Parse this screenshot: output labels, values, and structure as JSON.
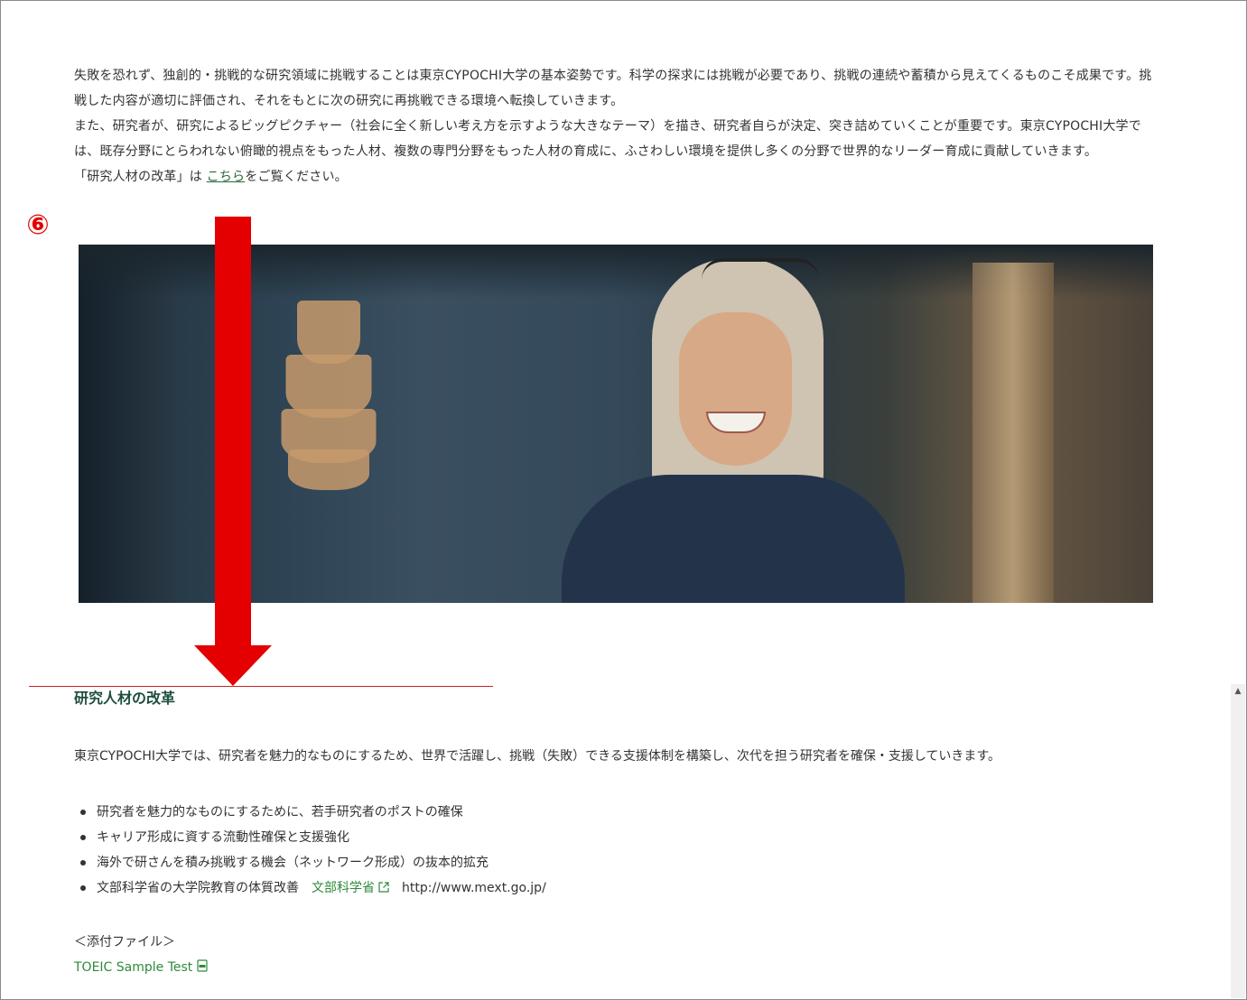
{
  "intro": {
    "paragraph1": "失敗を恐れず、独創的・挑戦的な研究領域に挑戦することは東京CYPOCHI大学の基本姿勢です。科学の探求には挑戦が必要であり、挑戦の連続や蓄積から見えてくるものこそ成果です。挑戦した内容が適切に評価され、それをもとに次の研究に再挑戦できる環境へ転換していきます。",
    "paragraph2": "また、研究者が、研究によるビッグピクチャー（社会に全く新しい考え方を示すような大きなテーマ）を描き、研究者自らが決定、突き詰めていくことが重要です。東京CYPOCHI大学では、既存分野にとらわれない俯瞰的視点をもった人材、複数の専門分野をもった人材の育成に、ふさわしい環境を提供し多くの分野で世界的なリーダー育成に貢献していきます。",
    "link_prefix": "「研究人材の改革」は ",
    "link_text": "こちら",
    "link_suffix": "をご覧ください。"
  },
  "annotation": {
    "step_marker": "⑥",
    "arrow_color": "#e40000"
  },
  "hero_image": {
    "alt": "smiling woman in a cafe"
  },
  "section": {
    "title": "研究人材の改革",
    "description": "東京CYPOCHI大学では、研究者を魅力的なものにするため、世界で活躍し、挑戦（失敗）できる支援体制を構築し、次代を担う研究者を確保・支援していきます。",
    "bullets": [
      "研究者を魅力的なものにするために、若手研究者のポストの確保",
      "キャリア形成に資する流動性確保と支援強化",
      "海外で研さんを積み挑戦する機会（ネットワーク形成）の抜本的拡充",
      "文部科学省の大学院教育の体質改善"
    ],
    "mext_link": "文部科学省",
    "mext_url": "http://www.mext.go.jp/",
    "attachments_heading": "＜添付ファイル＞",
    "attachment_link": "TOEIC Sample Test"
  },
  "colors": {
    "link_green": "#2e8b3a",
    "title_green": "#1f4e3d",
    "annotation_red": "#e40000"
  }
}
